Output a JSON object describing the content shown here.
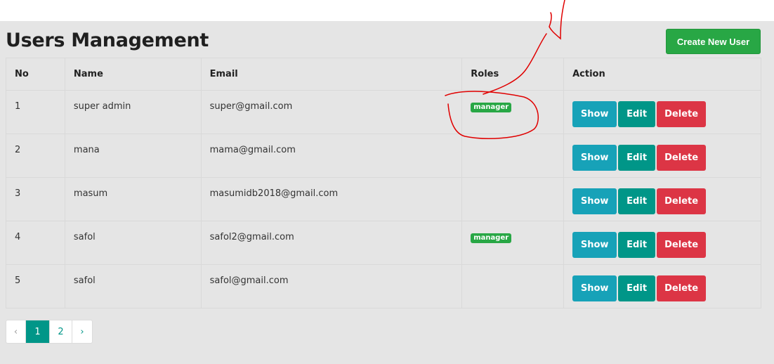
{
  "header": {
    "title": "Users Management",
    "create_button_label": "Create New User"
  },
  "table": {
    "columns": [
      "No",
      "Name",
      "Email",
      "Roles",
      "Action"
    ],
    "rows": [
      {
        "no": "1",
        "name": "super admin",
        "email": "super@gmail.com",
        "role": "manager"
      },
      {
        "no": "2",
        "name": "mana",
        "email": "mama@gmail.com",
        "role": ""
      },
      {
        "no": "3",
        "name": "masum",
        "email": "masumidb2018@gmail.com",
        "role": ""
      },
      {
        "no": "4",
        "name": "safol",
        "email": "safol2@gmail.com",
        "role": "manager"
      },
      {
        "no": "5",
        "name": "safol",
        "email": "safol@gmail.com",
        "role": ""
      }
    ],
    "actions": {
      "show": "Show",
      "edit": "Edit",
      "delete": "Delete"
    }
  },
  "pagination": {
    "prev": "‹",
    "pages": [
      "1",
      "2"
    ],
    "active_page": "1",
    "next": "›"
  },
  "colors": {
    "page_bg": "#e5e5e5",
    "create": "#28a745",
    "show": "#17a2b8",
    "edit": "#009688",
    "delete": "#dc3545",
    "badge": "#28a745",
    "annotation": "#e00000"
  }
}
